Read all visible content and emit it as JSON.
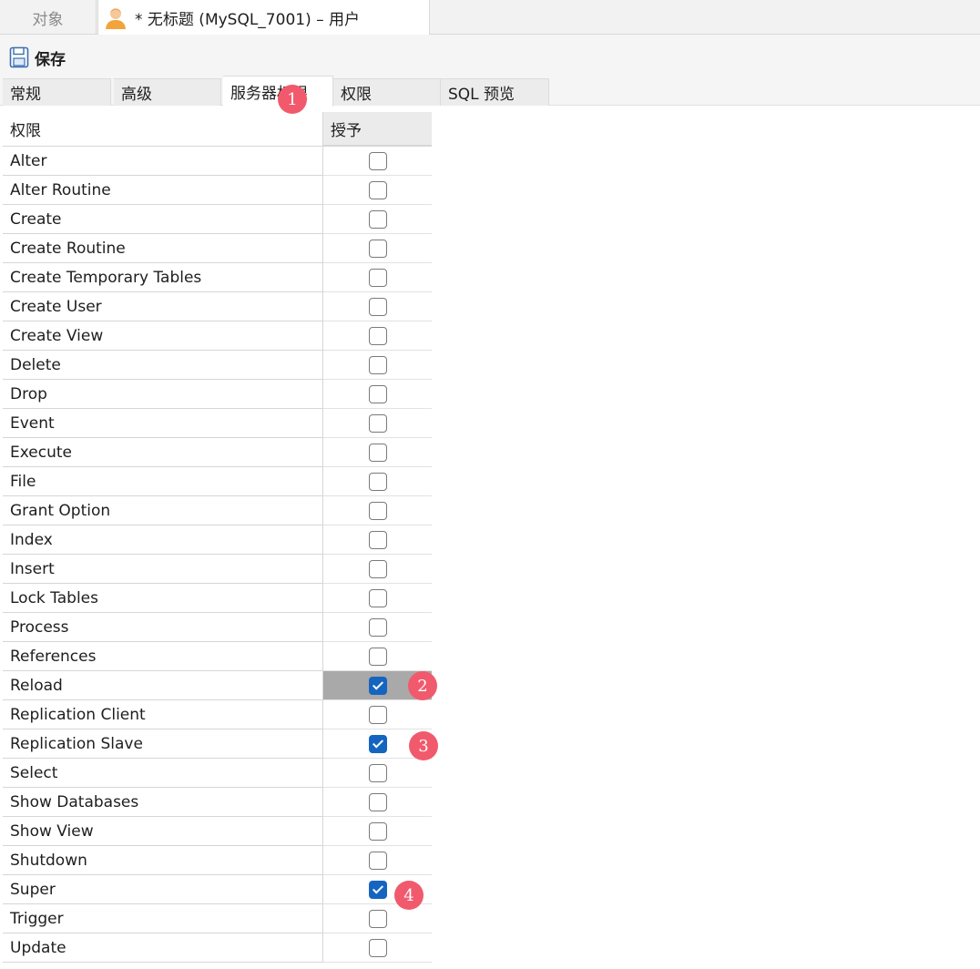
{
  "top_tabs": {
    "objects_label": "对象",
    "document_title": "* 无标题 (MySQL_7001) – 用户",
    "document_icon": "user-icon"
  },
  "toolbar": {
    "save_label": "保存",
    "save_icon": "save-icon"
  },
  "sub_tabs": [
    {
      "label": "常规"
    },
    {
      "label": "高级"
    },
    {
      "label": "服务器权限",
      "active": true
    },
    {
      "label": "权限"
    },
    {
      "label": "SQL 预览"
    }
  ],
  "table": {
    "headers": {
      "privilege": "权限",
      "grant": "授予"
    },
    "rows": [
      {
        "name": "Alter",
        "granted": false
      },
      {
        "name": "Alter Routine",
        "granted": false
      },
      {
        "name": "Create",
        "granted": false
      },
      {
        "name": "Create Routine",
        "granted": false
      },
      {
        "name": "Create Temporary Tables",
        "granted": false
      },
      {
        "name": "Create User",
        "granted": false
      },
      {
        "name": "Create View",
        "granted": false
      },
      {
        "name": "Delete",
        "granted": false
      },
      {
        "name": "Drop",
        "granted": false
      },
      {
        "name": "Event",
        "granted": false
      },
      {
        "name": "Execute",
        "granted": false
      },
      {
        "name": "File",
        "granted": false
      },
      {
        "name": "Grant Option",
        "granted": false
      },
      {
        "name": "Index",
        "granted": false
      },
      {
        "name": "Insert",
        "granted": false
      },
      {
        "name": "Lock Tables",
        "granted": false
      },
      {
        "name": "Process",
        "granted": false
      },
      {
        "name": "References",
        "granted": false
      },
      {
        "name": "Reload",
        "granted": true,
        "selected": true
      },
      {
        "name": "Replication Client",
        "granted": false
      },
      {
        "name": "Replication Slave",
        "granted": true
      },
      {
        "name": "Select",
        "granted": false
      },
      {
        "name": "Show Databases",
        "granted": false
      },
      {
        "name": "Show View",
        "granted": false
      },
      {
        "name": "Shutdown",
        "granted": false
      },
      {
        "name": "Super",
        "granted": true
      },
      {
        "name": "Trigger",
        "granted": false
      },
      {
        "name": "Update",
        "granted": false
      }
    ]
  },
  "markers": [
    "1",
    "2",
    "3",
    "4"
  ],
  "colors": {
    "checkbox_checked": "#1565c0",
    "marker": "#f15a6c",
    "selected_cell": "#a9a9a9"
  }
}
